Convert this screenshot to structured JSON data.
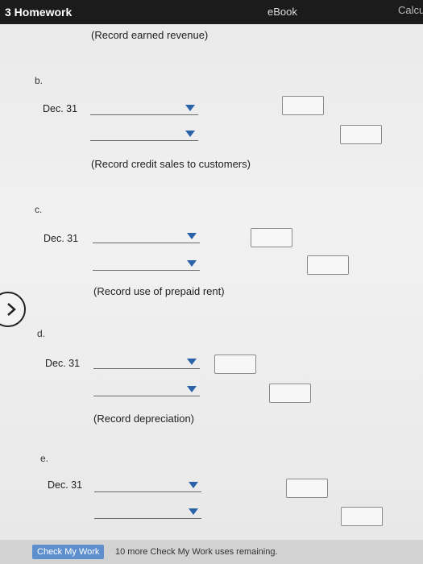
{
  "header": {
    "title": "3 Homework",
    "ebook_label": "eBook",
    "calc_label": "Calcu"
  },
  "entries": [
    {
      "note": "(Record earned revenue)"
    },
    {
      "letter": "b.",
      "date": "Dec. 31",
      "note": "(Record credit sales to customers)"
    },
    {
      "letter": "c.",
      "date": "Dec. 31",
      "note": "(Record use of prepaid rent)"
    },
    {
      "letter": "d.",
      "date": "Dec. 31",
      "note": "(Record depreciation)"
    },
    {
      "letter": "e.",
      "date": "Dec. 31"
    }
  ],
  "footer": {
    "check_button": "Check My Work",
    "remaining": "10 more Check My Work uses remaining."
  },
  "icons": {
    "dropdown": "caret-down-icon",
    "nav": "chevron-right-icon"
  },
  "colors": {
    "topbar": "#1b1b1b",
    "dropdown_arrow": "#2a62a8",
    "check_button": "#5d8fcf"
  }
}
